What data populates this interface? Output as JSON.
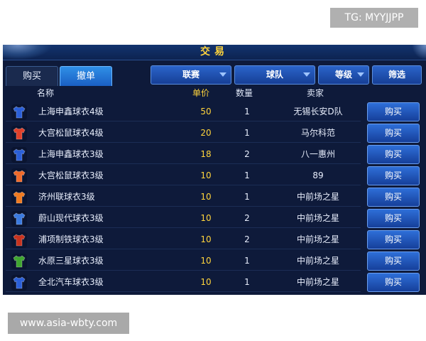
{
  "watermark_top": "TG: MYYJJPP",
  "watermark_bottom": "www.asia-wbty.com",
  "window": {
    "title": "交易"
  },
  "tabs": [
    {
      "label": "购买"
    },
    {
      "label": "撤单"
    }
  ],
  "filters": [
    {
      "label": "联赛"
    },
    {
      "label": "球队"
    },
    {
      "label": "等级"
    },
    {
      "label": "筛选"
    }
  ],
  "columns": {
    "name": "名称",
    "price": "单价",
    "qty": "数量",
    "seller": "卖家"
  },
  "rows": [
    {
      "name": "上海申鑫球衣4级",
      "price": "50",
      "qty": "1",
      "seller": "无锡长安D队",
      "buy": "购买",
      "color": "#2a5fd8"
    },
    {
      "name": "大宫松鼠球衣4级",
      "price": "20",
      "qty": "1",
      "seller": "马尔科范",
      "buy": "购买",
      "color": "#e0402a"
    },
    {
      "name": "上海申鑫球衣3级",
      "price": "18",
      "qty": "2",
      "seller": "八一惠州",
      "buy": "购买",
      "color": "#2a5fd8"
    },
    {
      "name": "大宫松鼠球衣3级",
      "price": "10",
      "qty": "1",
      "seller": "89",
      "buy": "购买",
      "color": "#f06a2a"
    },
    {
      "name": "济州联球衣3级",
      "price": "10",
      "qty": "1",
      "seller": "中前场之星",
      "buy": "购买",
      "color": "#f07a20"
    },
    {
      "name": "蔚山现代球衣3级",
      "price": "10",
      "qty": "2",
      "seller": "中前场之星",
      "buy": "购买",
      "color": "#3a7ae0"
    },
    {
      "name": "浦项制铁球衣3级",
      "price": "10",
      "qty": "2",
      "seller": "中前场之星",
      "buy": "购买",
      "color": "#c8321e"
    },
    {
      "name": "水原三星球衣3级",
      "price": "10",
      "qty": "1",
      "seller": "中前场之星",
      "buy": "购买",
      "color": "#3fa630"
    },
    {
      "name": "全北汽车球衣3级",
      "price": "10",
      "qty": "1",
      "seller": "中前场之星",
      "buy": "购买",
      "color": "#2a5fd8"
    }
  ]
}
